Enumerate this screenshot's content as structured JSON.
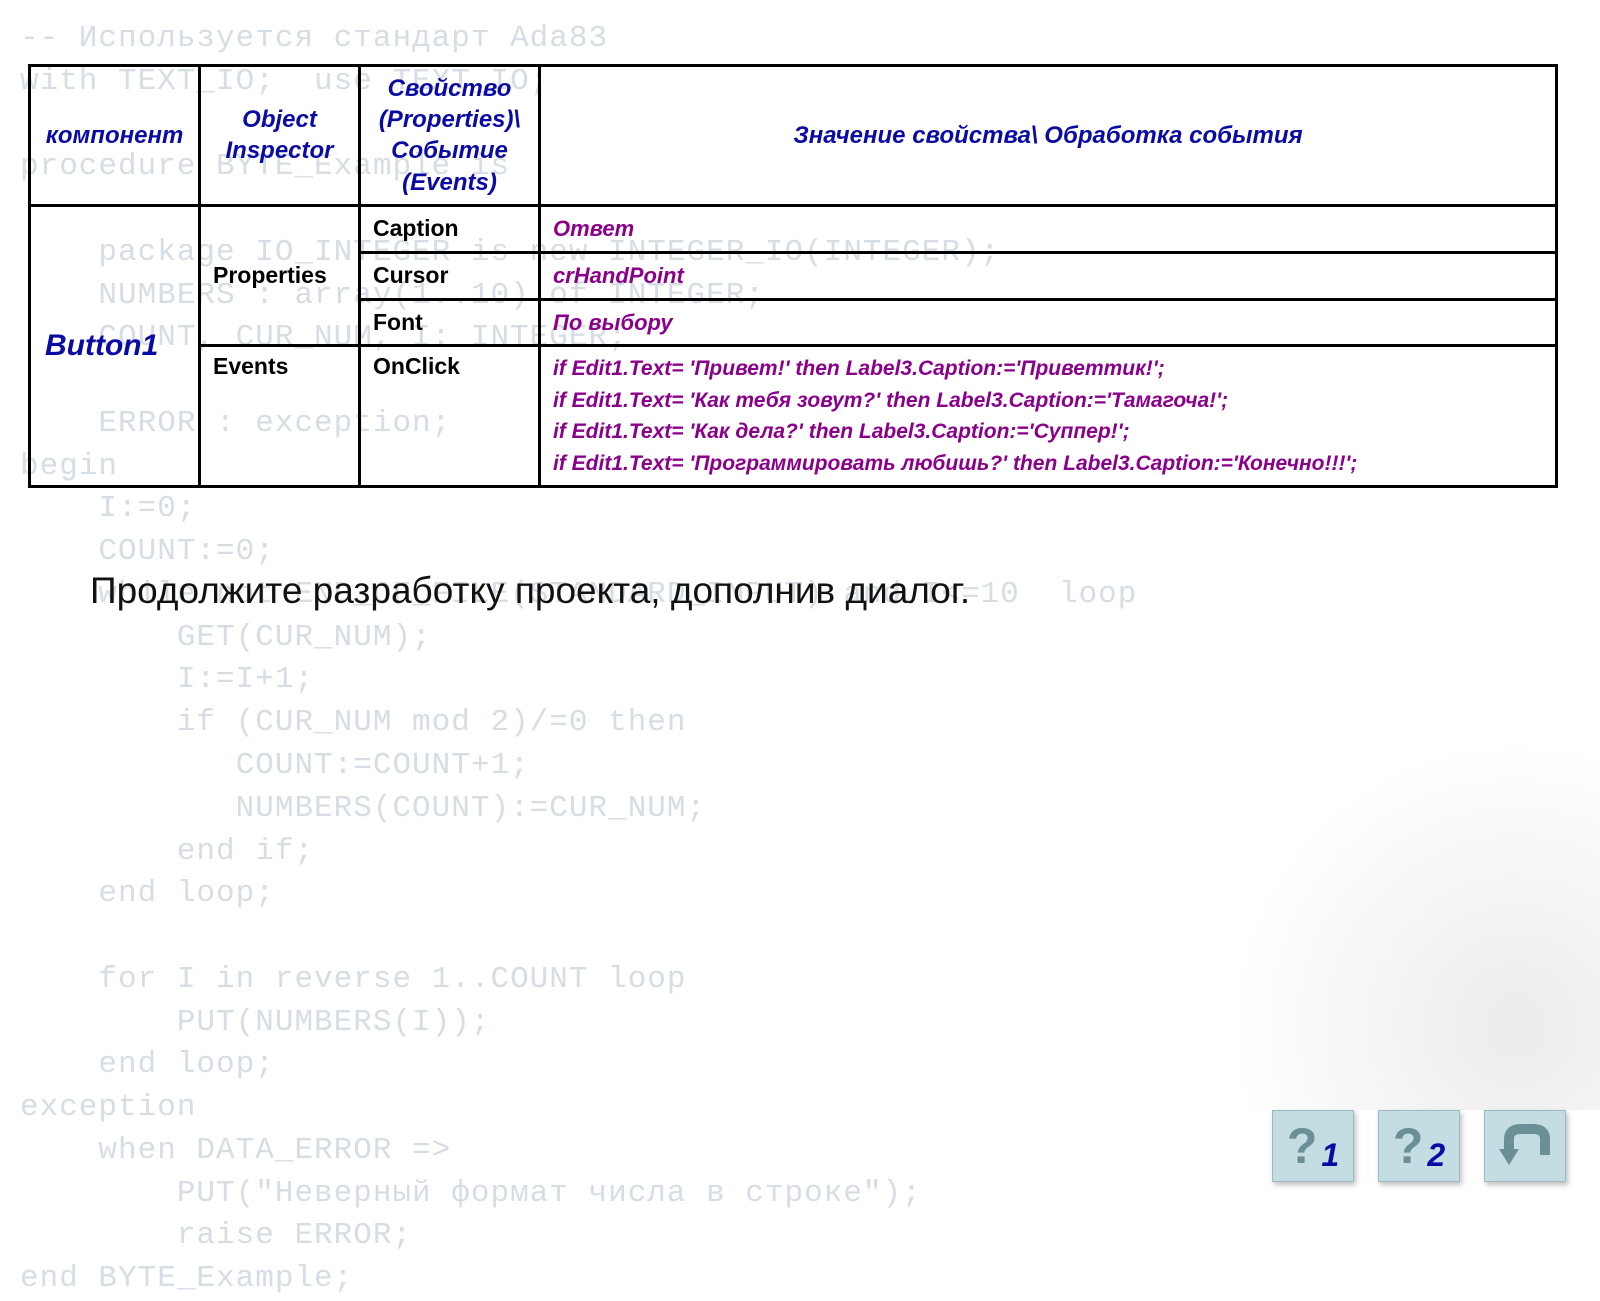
{
  "bgcode": "-- Используется стандарт Ada83\nwith TEXT_IO;  use TEXT_IO;\n\nprocedure BYTE_Example is\n\n    package IO_INTEGER is new INTEGER_IO(INTEGER);\n    NUMBERS : array(1..10) of INTEGER;\n    COUNT, CUR_NUM, I: INTEGER;\n\n    ERROR : exception;\nbegin\n    I:=0;\n    COUNT:=0;\n    while not END_OF_FILE(STANDARD_INPUT) and I<=10  loop\n        GET(CUR_NUM);\n        I:=I+1;\n        if (CUR_NUM mod 2)/=0 then\n           COUNT:=COUNT+1;\n           NUMBERS(COUNT):=CUR_NUM;\n        end if;\n    end loop;\n\n    for I in reverse 1..COUNT loop\n        PUT(NUMBERS(I));\n    end loop;\nexception\n    when DATA_ERROR =>\n        PUT(\"Неверный формат числа в строке\");\n        raise ERROR;\nend BYTE_Example;",
  "table": {
    "headers": {
      "component": "компонент",
      "inspector": "Object Inspector",
      "prop_event": "Свойство (Properties)\\ Событие (Events)",
      "value": "Значение свойства\\ Обработка события"
    },
    "component": "Button1",
    "sections": {
      "properties": "Properties",
      "events": "Events"
    },
    "rows": {
      "caption": {
        "name": "Caption",
        "value": "Ответ"
      },
      "cursor": {
        "name": "Cursor",
        "value": "crHandPoint"
      },
      "font": {
        "name": "Font",
        "value": "По выбору"
      },
      "onclick_name": "OnClick",
      "onclick_lines": [
        "if Edit1.Text= 'Привет!' then Label3.Caption:='Приветтик!';",
        "if Edit1.Text= 'Как тебя зовут?' then Label3.Caption:='Тамагоча!';",
        "if Edit1.Text= 'Как дела?' then Label3.Caption:='Суппер!';",
        "if Edit1.Text= 'Программировать любишь?' then Label3.Caption:='Конечно!!!';"
      ]
    }
  },
  "task_text": "Продолжите разработку проекта, дополнив диалог.",
  "footer": {
    "btn1": "1",
    "btn2": "2"
  }
}
